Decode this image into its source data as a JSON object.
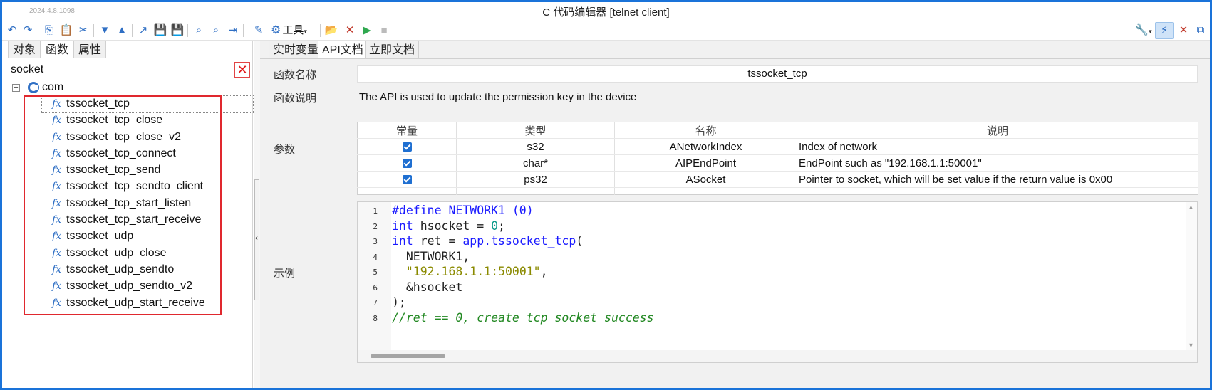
{
  "window": {
    "version": "2024.4.8.1098",
    "title": "C 代码编辑器 [telnet client]"
  },
  "toolbar": {
    "undo": "↶",
    "redo": "↷",
    "copy": "⎘",
    "paste": "📋",
    "cut": "✂",
    "down": "▼",
    "up": "▲",
    "export": "↗",
    "save": "💾",
    "save_all": "💾",
    "search": "⌕",
    "search_replace": "⌕",
    "goto": "⇥",
    "edit": "✎",
    "tools_label": "工具",
    "tools_caret": "▾",
    "open": "📂",
    "clear": "✕",
    "run": "▶",
    "stop": "■",
    "wrench": "🔧",
    "wrench_caret": "▾",
    "lightning": "⚡",
    "close_window": "✕",
    "detach": "⧉",
    "colors": {
      "accent": "#2f6fc4",
      "run": "#2fa84f",
      "frame": "#1a73d9"
    }
  },
  "left_panel": {
    "tabs": [
      {
        "label": "对象"
      },
      {
        "label": "函数"
      },
      {
        "label": "属性"
      }
    ],
    "active_tab": "函数",
    "search": {
      "value": "socket",
      "clear": "✕"
    },
    "tree": {
      "root": {
        "expander": "−",
        "label": "com"
      },
      "fx_icon": "fx",
      "functions": [
        "tssocket_tcp",
        "tssocket_tcp_close",
        "tssocket_tcp_close_v2",
        "tssocket_tcp_connect",
        "tssocket_tcp_send",
        "tssocket_tcp_sendto_client",
        "tssocket_tcp_start_listen",
        "tssocket_tcp_start_receive",
        "tssocket_udp",
        "tssocket_udp_close",
        "tssocket_udp_sendto",
        "tssocket_udp_sendto_v2",
        "tssocket_udp_start_receive"
      ],
      "selected": "tssocket_tcp"
    },
    "splitter_arrow": "‹"
  },
  "right_panel": {
    "tabs": [
      {
        "label": "实时变量"
      },
      {
        "label": "API文档"
      },
      {
        "label": "立即文档"
      }
    ],
    "active_tab": "API文档",
    "labels": {
      "name": "函数名称",
      "desc": "函数说明",
      "params": "参数",
      "example": "示例"
    },
    "function_name": "tssocket_tcp",
    "function_desc": "The API is used to update the permission key in the device",
    "param_headers": [
      "常量",
      "类型",
      "名称",
      "说明"
    ],
    "params": [
      {
        "type": "s32",
        "name": "ANetworkIndex",
        "desc": "Index of network"
      },
      {
        "type": "char*",
        "name": "AIPEndPoint",
        "desc": "EndPoint such as \"192.168.1.1:50001\""
      },
      {
        "type": "ps32",
        "name": "ASocket",
        "desc": "Pointer to socket, which will be set value if the return value is 0x00"
      }
    ],
    "code": {
      "line_numbers": [
        "1",
        "2",
        "3",
        "4",
        "5",
        "6",
        "7",
        "8"
      ],
      "l1_kw": "#define NETWORK1 (0)",
      "l2_kw": "int",
      "l2_a": " hsocket = ",
      "l2_num": "0",
      "l2_b": ";",
      "l3_kw": "int",
      "l3_a": " ret = ",
      "l3_fn": "app.tssocket_tcp",
      "l3_b": "(",
      "l4": "  NETWORK1,",
      "l5_indent": "  ",
      "l5_str": "\"192.168.1.1:50001\"",
      "l5_b": ",",
      "l6": "  &hsocket",
      "l7": ");",
      "l8_cmt": "//ret == 0, create tcp socket success"
    },
    "scroll_up": "▲",
    "scroll_down": "▼"
  }
}
